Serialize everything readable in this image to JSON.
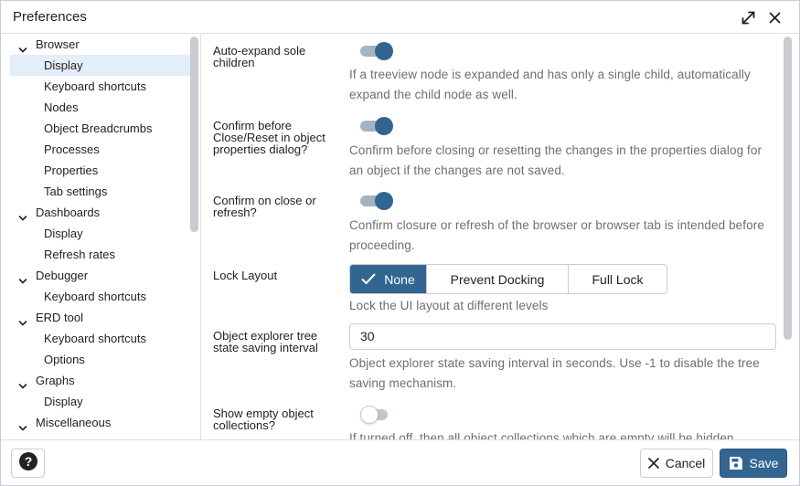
{
  "window": {
    "title": "Preferences",
    "expand_icon": "expand-icon",
    "close_icon": "close-icon"
  },
  "sidebar": {
    "items": [
      {
        "label": "Browser",
        "type": "group",
        "expanded": true
      },
      {
        "label": "Display",
        "type": "child",
        "selected": true
      },
      {
        "label": "Keyboard shortcuts",
        "type": "child"
      },
      {
        "label": "Nodes",
        "type": "child"
      },
      {
        "label": "Object Breadcrumbs",
        "type": "child"
      },
      {
        "label": "Processes",
        "type": "child"
      },
      {
        "label": "Properties",
        "type": "child"
      },
      {
        "label": "Tab settings",
        "type": "child"
      },
      {
        "label": "Dashboards",
        "type": "group",
        "expanded": true
      },
      {
        "label": "Display",
        "type": "child"
      },
      {
        "label": "Refresh rates",
        "type": "child"
      },
      {
        "label": "Debugger",
        "type": "group",
        "expanded": true
      },
      {
        "label": "Keyboard shortcuts",
        "type": "child"
      },
      {
        "label": "ERD tool",
        "type": "group",
        "expanded": true
      },
      {
        "label": "Keyboard shortcuts",
        "type": "child"
      },
      {
        "label": "Options",
        "type": "child"
      },
      {
        "label": "Graphs",
        "type": "group",
        "expanded": true
      },
      {
        "label": "Display",
        "type": "child"
      },
      {
        "label": "Miscellaneous",
        "type": "group",
        "expanded": true
      }
    ]
  },
  "settings": {
    "auto_expand": {
      "label": "Auto-expand sole children",
      "enabled": true,
      "description": "If a treeview node is expanded and has only a single child, automatically expand the child node as well."
    },
    "confirm_reset": {
      "label": "Confirm before Close/Reset in object properties dialog?",
      "enabled": true,
      "description": "Confirm before closing or resetting the changes in the properties dialog for an object if the changes are not saved."
    },
    "confirm_close": {
      "label": "Confirm on close or refresh?",
      "enabled": true,
      "description": "Confirm closure or refresh of the browser or browser tab is intended before proceeding."
    },
    "lock_layout": {
      "label": "Lock Layout",
      "options": [
        "None",
        "Prevent Docking",
        "Full Lock"
      ],
      "selected": "None",
      "description": "Lock the UI layout at different levels"
    },
    "tree_state_interval": {
      "label": "Object explorer tree state saving interval",
      "value": "30",
      "description": "Object explorer state saving interval in seconds. Use -1 to disable the tree saving mechanism."
    },
    "show_empty": {
      "label": "Show empty object collections?",
      "enabled": false,
      "description": "If turned off, then all object collections which are empty will be hidden"
    }
  },
  "footer": {
    "help_icon": "help-icon",
    "cancel_label": "Cancel",
    "save_label": "Save"
  },
  "colors": {
    "accent": "#326690",
    "selected_row": "#e3eef9",
    "description_text": "#6b6f76"
  }
}
